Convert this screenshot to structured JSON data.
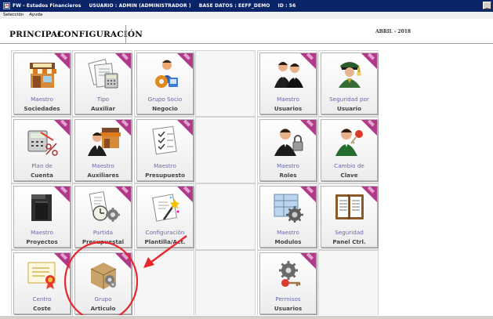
{
  "window": {
    "app_title": "FW - Estados Financieros",
    "user": "USUARIO : ADMIN (ADMINISTRADOR )",
    "database": "BASE DATOS : EEFF_DEMO",
    "id": "ID : 56"
  },
  "menu": [
    {
      "label": "Selección"
    },
    {
      "label": "Ayuda"
    }
  ],
  "tabs": {
    "principal": "PRINCIPAL",
    "configuracion": "CONFIGURACIÓN"
  },
  "period": "ABRIL - 2018",
  "tiles": [
    {
      "key": "sociedades",
      "line1": "Maestro",
      "line2": "Sociedades",
      "icon": "store-icon"
    },
    {
      "key": "auxiliar",
      "line1": "Tipo",
      "line2": "Auxiliar",
      "icon": "documents-calculator-icon"
    },
    {
      "key": "negocio",
      "line1": "Grupo Socio",
      "line2": "Negocio",
      "icon": "user-gear-icon"
    },
    {
      "key": "usuarios",
      "line1": "Maestro",
      "line2": "Usuarios",
      "icon": "users-icon"
    },
    {
      "key": "seguridad-usuario",
      "line1": "Seguridad por",
      "line2": "Usuario",
      "icon": "officer-icon"
    },
    {
      "key": "cuenta",
      "line1": "Plan de",
      "line2": "Cuenta",
      "icon": "calculator-percent-icon"
    },
    {
      "key": "auxiliares",
      "line1": "Maestro",
      "line2": "Auxiliares",
      "icon": "user-store-icon"
    },
    {
      "key": "presupuesto",
      "line1": "Maestro",
      "line2": "Presupuesto",
      "icon": "check-document-icon"
    },
    {
      "key": "roles",
      "line1": "Maestro",
      "line2": "Roles",
      "icon": "user-lock-icon"
    },
    {
      "key": "clave",
      "line1": "Cambio de",
      "line2": "Clave",
      "icon": "user-key-icon"
    },
    {
      "key": "proyectos",
      "line1": "Maestro",
      "line2": "Proyectos",
      "icon": "document-flow-icon"
    },
    {
      "key": "presupuestal",
      "line1": "Partida",
      "line2": "Presupuestal",
      "icon": "clock-gear-icon"
    },
    {
      "key": "plantilla",
      "line1": "Configuración",
      "line2": "Plantilla/Act.",
      "icon": "wand-document-icon"
    },
    {
      "key": "modulos",
      "line1": "Maestro",
      "line2": "Modulos",
      "icon": "window-gear-icon"
    },
    {
      "key": "panel",
      "line1": "Seguridad",
      "line2": "Panel Ctrl.",
      "icon": "ledger-icon"
    },
    {
      "key": "coste",
      "line1": "Centro",
      "line2": "Coste",
      "icon": "certificate-icon"
    },
    {
      "key": "articulo",
      "line1": "Grupo",
      "line2": "Articulo",
      "icon": "box-gear-icon"
    },
    {
      "key": "permisos",
      "line1": "Permisos",
      "line2": "Usuarios",
      "icon": "gear-key-icon"
    }
  ],
  "colors": {
    "titlebar": "#0a246a",
    "ribbon": "#b03a8a",
    "annotation": "#e8262c",
    "label_top": "#6a6aa8"
  }
}
